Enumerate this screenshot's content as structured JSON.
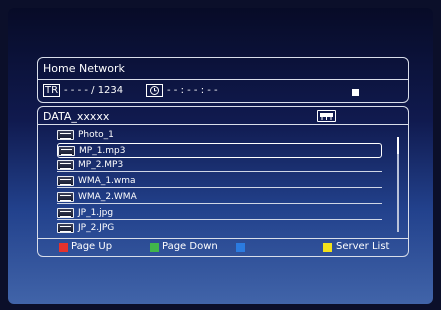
{
  "header": {
    "title": "Home Network",
    "track_badge": "TR",
    "track_text": "- - - - / 1234",
    "time_icon": "clock-icon",
    "time_text": "- - : - - : - -"
  },
  "folder": {
    "name": "DATA_xxxxx",
    "type_icon": "network-drive-icon"
  },
  "items": [
    {
      "label": "Photo_1",
      "icon": "folder-icon"
    },
    {
      "label": "MP_1.mp3",
      "icon": "audio-file-icon"
    },
    {
      "label": "MP_2.MP3",
      "icon": "audio-file-icon"
    },
    {
      "label": "WMA_1.wma",
      "icon": "audio-file-icon"
    },
    {
      "label": "WMA_2.WMA",
      "icon": "audio-file-icon"
    },
    {
      "label": "JP_1.jpg",
      "icon": "image-file-icon"
    },
    {
      "label": "JP_2.JPG",
      "icon": "image-file-icon"
    }
  ],
  "selected_index": 1,
  "footer": {
    "red_label": "Page Up",
    "green_label": "Page Down",
    "blue_label": "",
    "yellow_label": "Server List"
  },
  "colors": {
    "red": "#e6322d",
    "green": "#41b64a",
    "blue": "#2b7be0",
    "yellow": "#f2e11a"
  }
}
